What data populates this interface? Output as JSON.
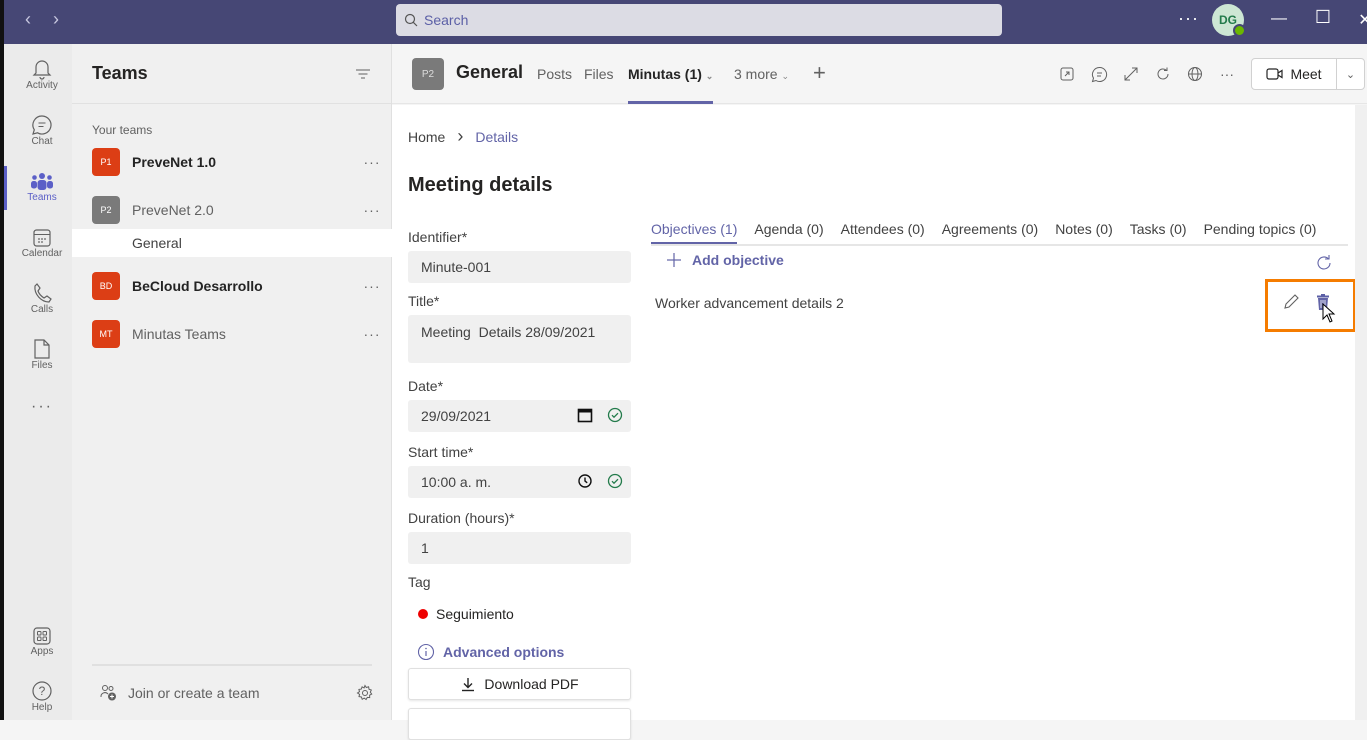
{
  "titlebar": {
    "search_placeholder": "Search",
    "more": "···",
    "avatar_initials": "DG",
    "minimize": "—",
    "maximize": "☐",
    "close": "✕"
  },
  "rail": {
    "items": [
      {
        "label": "Activity",
        "icon": "bell-icon"
      },
      {
        "label": "Chat",
        "icon": "chat-icon"
      },
      {
        "label": "Teams",
        "icon": "teams-icon",
        "active": true
      },
      {
        "label": "Calendar",
        "icon": "calendar-icon"
      },
      {
        "label": "Calls",
        "icon": "phone-icon"
      },
      {
        "label": "Files",
        "icon": "file-icon"
      }
    ],
    "more": "···",
    "apps": "Apps",
    "help": "Help"
  },
  "teams_panel": {
    "title": "Teams",
    "section_label": "Your teams",
    "teams": [
      {
        "initials": "P1",
        "name": "PreveNet 1.0",
        "color": "#dc3e15",
        "bold": true
      },
      {
        "initials": "P2",
        "name": "PreveNet 2.0",
        "color": "#7a7a7a",
        "bold": false
      },
      {
        "initials": "BD",
        "name": "BeCloud Desarrollo",
        "color": "#dc3e15",
        "bold": true
      },
      {
        "initials": "MT",
        "name": "Minutas Teams",
        "color": "#dc3e15",
        "bold": false
      }
    ],
    "channel": "General",
    "dots": "···",
    "join_label": "Join or create a team"
  },
  "header": {
    "channel_initials": "P2",
    "channel_name": "General",
    "tabs": [
      "Posts",
      "Files",
      "Minutas (1)",
      "3 more"
    ],
    "active_tab": "Minutas (1)",
    "add_tab": "+",
    "meet_label": "Meet"
  },
  "breadcrumb": {
    "home": "Home",
    "separator": "›",
    "current": "Details"
  },
  "page_title": "Meeting details",
  "form": {
    "identifier_label": "Identifier*",
    "identifier_value": "Minute-001",
    "title_label": "Title*",
    "title_value": "Meeting  Details 28/09/2021",
    "date_label": "Date*",
    "date_value": "29/09/2021",
    "start_label": "Start time*",
    "start_value": "10:00 a. m.",
    "duration_label": "Duration (hours)*",
    "duration_value": "1",
    "tag_label": "Tag",
    "tag_value": "Seguimiento",
    "tag_color": "#e00000",
    "advanced_options": "Advanced options",
    "download_pdf": "Download PDF"
  },
  "subtabs": [
    {
      "label": "Objectives (1)",
      "active": true
    },
    {
      "label": "Agenda (0)"
    },
    {
      "label": "Attendees (0)"
    },
    {
      "label": "Agreements (0)"
    },
    {
      "label": "Notes (0)"
    },
    {
      "label": "Tasks (0)"
    },
    {
      "label": "Pending topics (0)"
    }
  ],
  "objectives": {
    "add_label": "Add objective",
    "items": [
      {
        "text": "Worker advancement details 2"
      }
    ]
  },
  "colors": {
    "accent": "#6264a7",
    "titlebar": "#464775",
    "highlight": "#f57c00",
    "success": "#237b4b"
  }
}
